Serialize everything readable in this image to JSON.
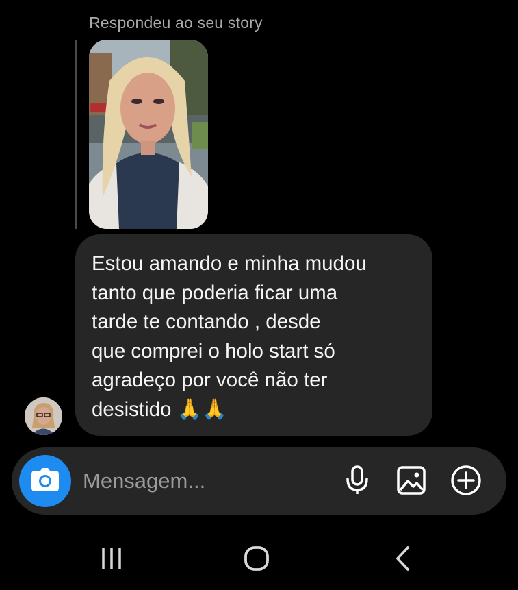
{
  "story_reply": {
    "caption": "Respondeu ao seu story"
  },
  "message": {
    "text": "Estou amando e minha mudou\ntanto que poderia ficar uma\ntarde te contando , desde\nque comprei o holo start só\nagradeço por você não ter\ndesistido 🙏🙏"
  },
  "composer": {
    "placeholder": "Mensagem...",
    "camera_icon": "camera-icon",
    "mic_icon": "microphone-icon",
    "gallery_icon": "image-gallery-icon",
    "plus_icon": "plus-circle-icon"
  },
  "navigation": {
    "recent_icon": "recent-apps-icon",
    "home_icon": "home-icon",
    "back_icon": "back-chevron-icon"
  },
  "colors": {
    "background": "#000000",
    "bubble": "#262626",
    "accent": "#1d8bf0",
    "caption": "#a8a8a8"
  }
}
